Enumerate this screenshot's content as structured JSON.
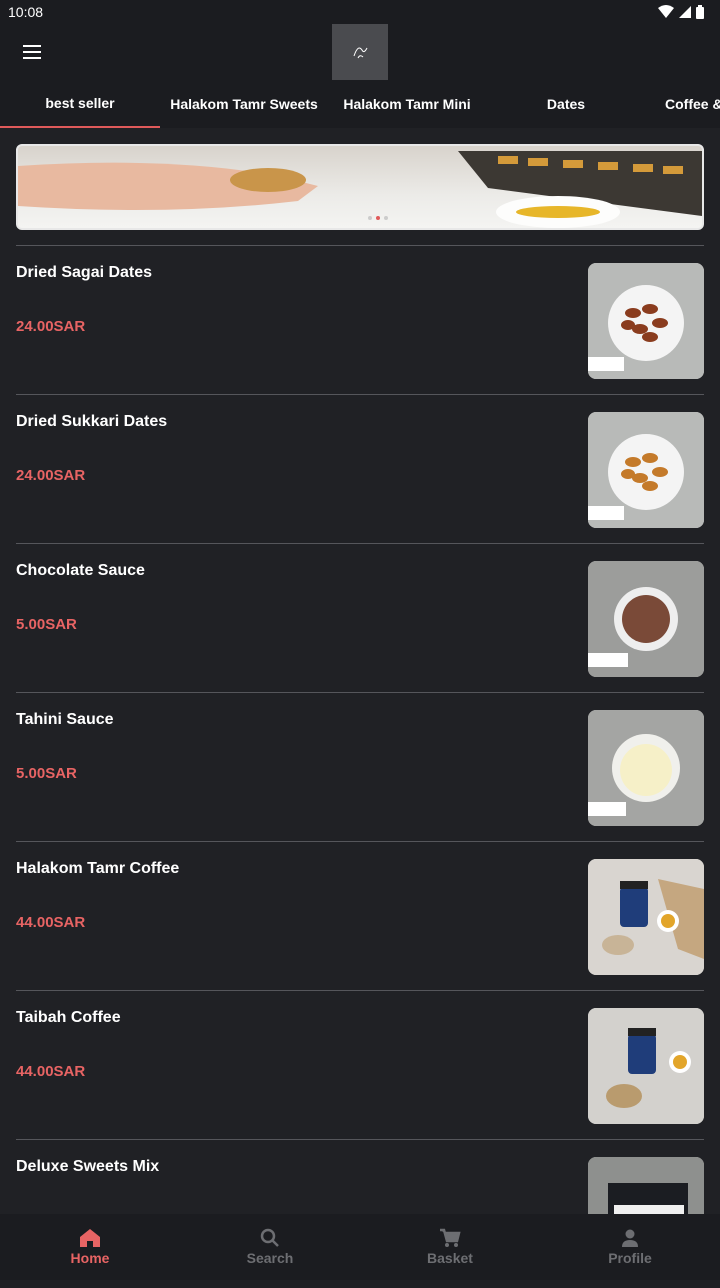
{
  "status": {
    "time": "10:08"
  },
  "tabs": [
    {
      "label": "best seller"
    },
    {
      "label": "Halakom Tamr Sweets"
    },
    {
      "label": "Halakom Tamr Mini"
    },
    {
      "label": "Dates"
    },
    {
      "label": "Coffee &"
    }
  ],
  "products": [
    {
      "name": "Dried Sagai Dates",
      "price": "24.00SAR",
      "icon": "dates-bowl-image"
    },
    {
      "name": "Dried Sukkari Dates",
      "price": "24.00SAR",
      "icon": "dates-bowl-image"
    },
    {
      "name": "Chocolate Sauce",
      "price": "5.00SAR",
      "icon": "sauce-cup-image"
    },
    {
      "name": "Tahini Sauce",
      "price": "5.00SAR",
      "icon": "sauce-cup-image"
    },
    {
      "name": "Halakom Tamr Coffee",
      "price": "44.00SAR",
      "icon": "coffee-jar-image"
    },
    {
      "name": "Taibah Coffee",
      "price": "44.00SAR",
      "icon": "coffee-jar-image"
    },
    {
      "name": "Deluxe Sweets Mix",
      "price": "",
      "icon": "sweets-box-image"
    }
  ],
  "nav": [
    {
      "label": "Home",
      "icon": "home-icon"
    },
    {
      "label": "Search",
      "icon": "search-icon"
    },
    {
      "label": "Basket",
      "icon": "cart-icon"
    },
    {
      "label": "Profile",
      "icon": "person-icon"
    }
  ],
  "colors": {
    "accent": "#e86464",
    "background": "#202125"
  }
}
